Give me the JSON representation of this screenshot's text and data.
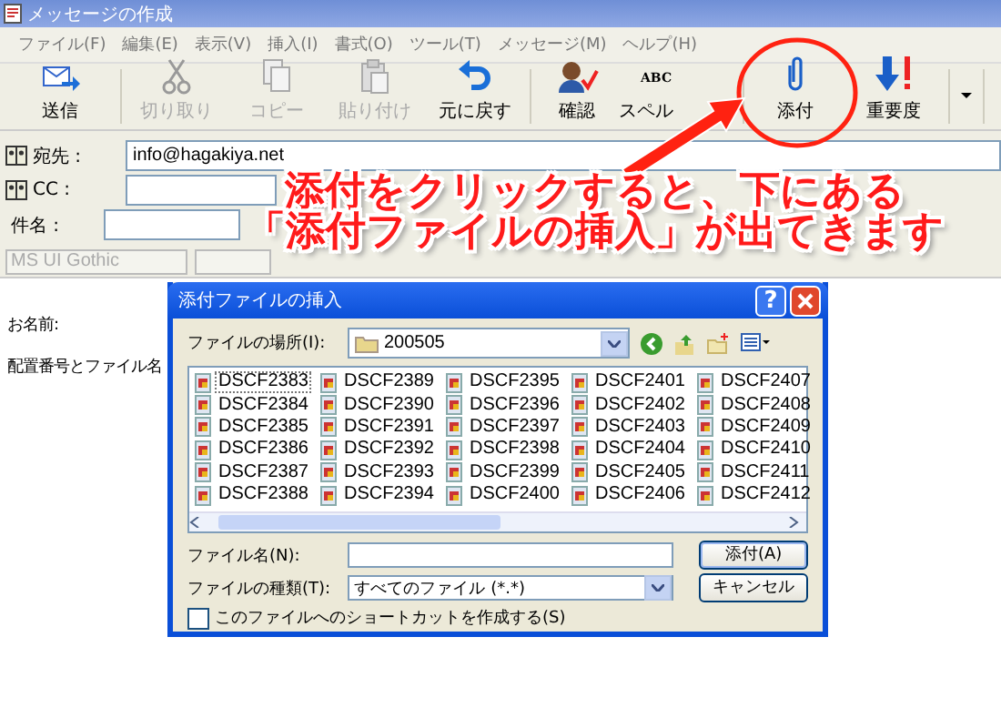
{
  "window": {
    "title": "メッセージの作成"
  },
  "menu": [
    "ファイル(F)",
    "編集(E)",
    "表示(V)",
    "挿入(I)",
    "書式(O)",
    "ツール(T)",
    "メッセージ(M)",
    "ヘルプ(H)"
  ],
  "toolbar": [
    {
      "label": "送信",
      "disabled": false
    },
    {
      "label": "切り取り",
      "disabled": true
    },
    {
      "label": "コピー",
      "disabled": true
    },
    {
      "label": "貼り付け",
      "disabled": true
    },
    {
      "label": "元に戻す",
      "disabled": false
    },
    {
      "label": "確認",
      "disabled": false
    },
    {
      "label": "スペル",
      "icon_text": "ABC",
      "disabled": false
    },
    {
      "label": "添付",
      "disabled": false
    },
    {
      "label": "重要度",
      "disabled": false
    }
  ],
  "fields": [
    {
      "kind": "address",
      "label": "宛先 :",
      "value": "info@hagakiya.net"
    },
    {
      "kind": "address",
      "label": "CC :"
    },
    {
      "kind": "plain",
      "label": "件名 :"
    }
  ],
  "format_bar": {
    "font": "MS UI Gothic"
  },
  "body_lines": [
    "お名前:",
    "配置番号とファイル名"
  ],
  "dialog": {
    "title": "添付ファイルの挿入",
    "help": "?",
    "location_label": "ファイルの場所(I):",
    "location": "200505",
    "files": [
      {
        "name": "DSCF2383",
        "selected": true
      },
      {
        "name": "DSCF2384",
        "selected": false
      },
      {
        "name": "DSCF2385",
        "selected": false
      },
      {
        "name": "DSCF2386",
        "selected": false
      },
      {
        "name": "DSCF2387",
        "selected": false
      },
      {
        "name": "DSCF2388",
        "selected": false
      },
      {
        "name": "DSCF2389",
        "selected": false
      },
      {
        "name": "DSCF2390",
        "selected": false
      },
      {
        "name": "DSCF2391",
        "selected": false
      },
      {
        "name": "DSCF2392",
        "selected": false
      },
      {
        "name": "DSCF2393",
        "selected": false
      },
      {
        "name": "DSCF2394",
        "selected": false
      },
      {
        "name": "DSCF2395",
        "selected": false
      },
      {
        "name": "DSCF2396",
        "selected": false
      },
      {
        "name": "DSCF2397",
        "selected": false
      },
      {
        "name": "DSCF2398",
        "selected": false
      },
      {
        "name": "DSCF2399",
        "selected": false
      },
      {
        "name": "DSCF2400",
        "selected": false
      },
      {
        "name": "DSCF2401",
        "selected": false
      },
      {
        "name": "DSCF2402",
        "selected": false
      },
      {
        "name": "DSCF2403",
        "selected": false
      },
      {
        "name": "DSCF2404",
        "selected": false
      },
      {
        "name": "DSCF2405",
        "selected": false
      },
      {
        "name": "DSCF2406",
        "selected": false
      },
      {
        "name": "DSCF2407",
        "selected": false
      },
      {
        "name": "DSCF2408",
        "selected": false
      },
      {
        "name": "DSCF2409",
        "selected": false
      },
      {
        "name": "DSCF2410",
        "selected": false
      },
      {
        "name": "DSCF2411",
        "selected": false
      },
      {
        "name": "DSCF2412",
        "selected": false
      }
    ],
    "filename_label": "ファイル名(N):",
    "filetype_label": "ファイルの種類(T):",
    "filetype": "すべてのファイル (*.*)",
    "buttons": [
      "添付(A)",
      "キャンセル"
    ],
    "shortcut": {
      "label": "このファイルへのショートカットを作成する(S)",
      "checked": false
    }
  },
  "annotation": {
    "lines": [
      "添付をクリックすると、下にある",
      "「添付ファイルの挿入」が出てきます"
    ]
  }
}
